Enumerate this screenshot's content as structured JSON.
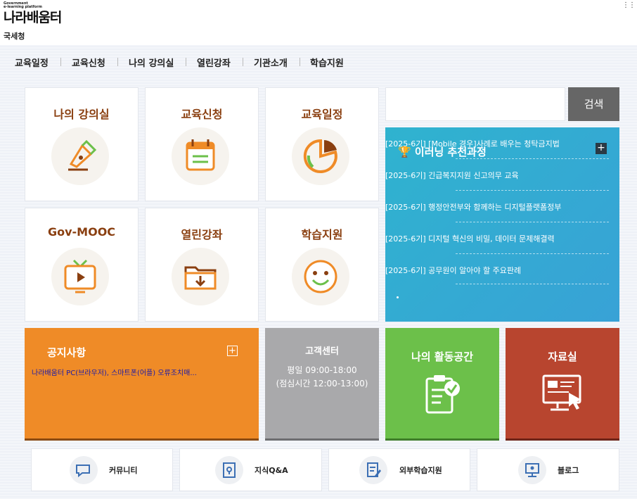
{
  "header": {
    "logo_small": "Government\ne-learning platform",
    "logo_main": "나라배움터",
    "agency": "국세청",
    "dots": "⋮⋮"
  },
  "gnb": [
    "교육일정",
    "교육신청",
    "나의 강의실",
    "열린강좌",
    "기관소개",
    "학습지원"
  ],
  "tiles": [
    {
      "title": "나의 강의실",
      "icon": "pen-nib-icon"
    },
    {
      "title": "교육신청",
      "icon": "calendar-icon"
    },
    {
      "title": "교육일정",
      "icon": "pie-chart-icon"
    },
    {
      "title": "Gov-MOOC",
      "icon": "tv-play-icon"
    },
    {
      "title": "열린강좌",
      "icon": "folder-download-icon"
    },
    {
      "title": "학습지원",
      "icon": "smiley-icon"
    }
  ],
  "search": {
    "placeholder": "",
    "button": "검색"
  },
  "elearning": {
    "title": "이러닝 추천과정",
    "plus": "+",
    "courses": [
      "[2025-6기] [Mobile 경우]사례로 배우는 청탁금지법",
      "[2025-6기] 긴급복지지원 신고의무 교육",
      "[2025-6기] 행정안전부와 함께하는 디지털플랫폼정부",
      "[2025-6기] 디지털 혁신의 비밀, 데이터 문제해결력",
      "[2025-6기] 공무원이 알아야 할 주요판례"
    ]
  },
  "notice": {
    "title": "공지사항",
    "plus": "+",
    "item": "나라배움터 PC(브라우저), 스마트폰(어플) 오류조치매..."
  },
  "customer_center": {
    "title": "고객센터",
    "hours": "평일 09:00-18:00",
    "break": "(점심시간 12:00-13:00)"
  },
  "activity": {
    "title": "나의 활동공간",
    "icon": "clipboard-check-icon"
  },
  "resources": {
    "title": "자료실",
    "icon": "monitor-click-icon"
  },
  "bottom_links": [
    {
      "label": "커뮤니티",
      "icon": "chat-icon"
    },
    {
      "label": "지식Q&A",
      "icon": "location-doc-icon"
    },
    {
      "label": "외부학습지원",
      "icon": "document-edit-icon"
    },
    {
      "label": "블로그",
      "icon": "blog-monitor-icon"
    }
  ]
}
